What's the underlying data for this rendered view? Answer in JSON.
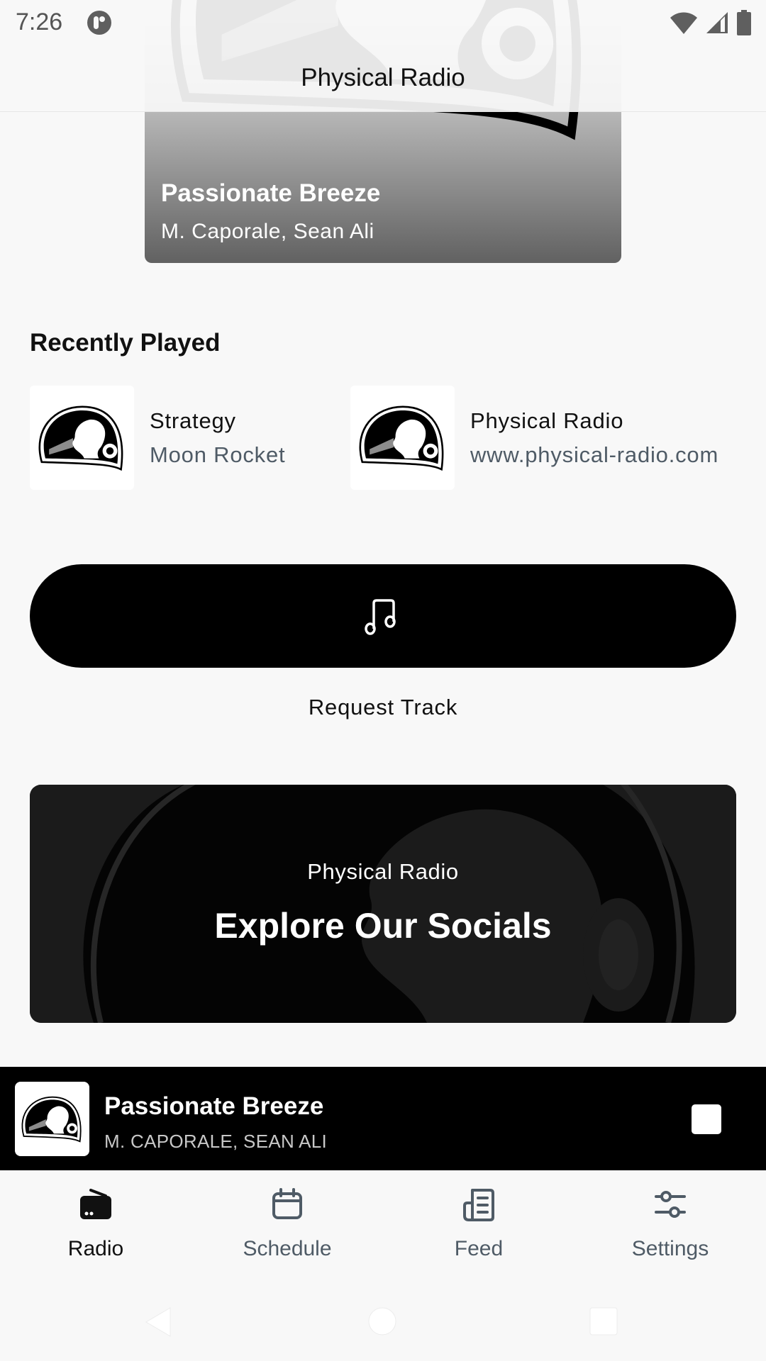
{
  "status_bar": {
    "time": "7:26",
    "icons": [
      "app-notification-icon",
      "wifi-icon",
      "cellular-signal-icon",
      "battery-icon"
    ]
  },
  "header": {
    "title": "Physical Radio"
  },
  "now_playing_card": {
    "title": "Passionate Breeze",
    "artists": "M. Caporale, Sean Ali"
  },
  "recently_played": {
    "heading": "Recently Played",
    "items": [
      {
        "title": "Strategy",
        "subtitle": "Moon Rocket"
      },
      {
        "title": "Physical Radio",
        "subtitle": "www.physical-radio.com"
      }
    ]
  },
  "request": {
    "icon": "music-note-icon",
    "label": "Request Track"
  },
  "socials": {
    "kicker": "Physical Radio",
    "title": "Explore Our Socials"
  },
  "mini_player": {
    "title": "Passionate Breeze",
    "artists": "M. CAPORALE, SEAN ALI",
    "control": "stop-icon"
  },
  "bottom_nav": {
    "active": "Radio",
    "items": [
      {
        "label": "Radio",
        "icon": "radio-icon"
      },
      {
        "label": "Schedule",
        "icon": "calendar-icon"
      },
      {
        "label": "Feed",
        "icon": "newspaper-icon"
      },
      {
        "label": "Settings",
        "icon": "sliders-icon"
      }
    ]
  },
  "colors": {
    "background": "#f8f8f8",
    "primary": "#000000",
    "secondary_text": "#4f5b66",
    "on_dark": "#ffffff"
  }
}
